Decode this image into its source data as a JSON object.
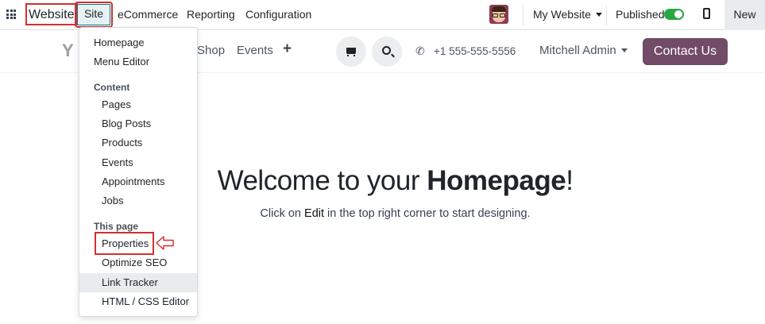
{
  "topbar": {
    "app_name": "Website",
    "menu": [
      "Site",
      "eCommerce",
      "Reporting",
      "Configuration"
    ],
    "website_selector": "My Website",
    "published_label": "Published",
    "published": true,
    "new_label": "New"
  },
  "site_header": {
    "nav": [
      "Shop",
      "Events"
    ],
    "phone": "+1 555-555-5556",
    "user": "Mitchell Admin",
    "contact_button": "Contact Us"
  },
  "dropdown": {
    "top_items": [
      "Homepage",
      "Menu Editor"
    ],
    "content_header": "Content",
    "content_items": [
      "Pages",
      "Blog Posts",
      "Products",
      "Events",
      "Appointments",
      "Jobs"
    ],
    "this_page_header": "This page",
    "page_items": [
      "Properties",
      "Optimize SEO",
      "Link Tracker",
      "HTML / CSS Editor"
    ]
  },
  "main": {
    "welcome_prefix": "Welcome to your ",
    "welcome_bold": "Homepage",
    "welcome_suffix": "!",
    "hint_prefix": "Click on ",
    "hint_bold": "Edit",
    "hint_suffix": " in the top right corner to start designing."
  },
  "colors": {
    "annotation_red": "#d32f2f",
    "brand_purple": "#714b67",
    "toggle_green": "#28a745"
  },
  "icons": [
    "apps-grid-icon",
    "avatar",
    "caret-down-icon",
    "toggle-switch",
    "mobile-preview-icon",
    "plus-icon",
    "cart-icon",
    "search-icon",
    "phone-icon",
    "arrow-annotation"
  ]
}
